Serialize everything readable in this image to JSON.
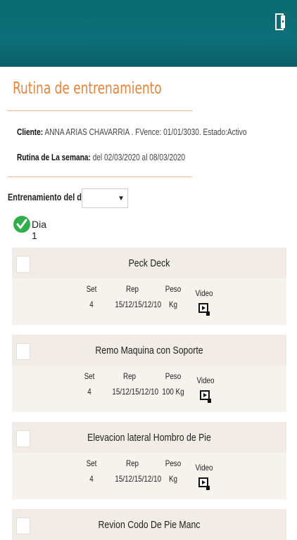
{
  "header": {
    "logout_icon": "logout-icon"
  },
  "page": {
    "title": "Rutina de entrenamiento"
  },
  "client": {
    "label": "Cliente:",
    "value": "ANNA ARIAS CHAVARRIA . FVence: 01/01/3030. Estado:Activo"
  },
  "week": {
    "label": "Rutina de La semana:",
    "value": "del 02/03/2020 al 08/03/2020"
  },
  "day_select": {
    "label": "Entrenamiento del dia:",
    "selected": ""
  },
  "day": {
    "name": "Dia 1"
  },
  "columns": {
    "set": "Set",
    "rep": "Rep",
    "peso": "Peso",
    "video": "Video"
  },
  "exercises": [
    {
      "name": "Peck Deck",
      "set": "4",
      "rep": "15/12/15/12/10",
      "peso": "Kg"
    },
    {
      "name": "Remo Maquina con Soporte",
      "set": "4",
      "rep": "15/12/15/12/10",
      "peso": "100 Kg"
    },
    {
      "name": "Elevacion lateral Hombro de Pie",
      "set": "4",
      "rep": "15/12/15/12/10",
      "peso": "Kg"
    },
    {
      "name": "Revion Codo De Pie Manc",
      "set": "",
      "rep": "",
      "peso": ""
    }
  ],
  "colors": {
    "header": "#0d6f78",
    "accent": "#e8843a",
    "check": "#2fae4b"
  }
}
